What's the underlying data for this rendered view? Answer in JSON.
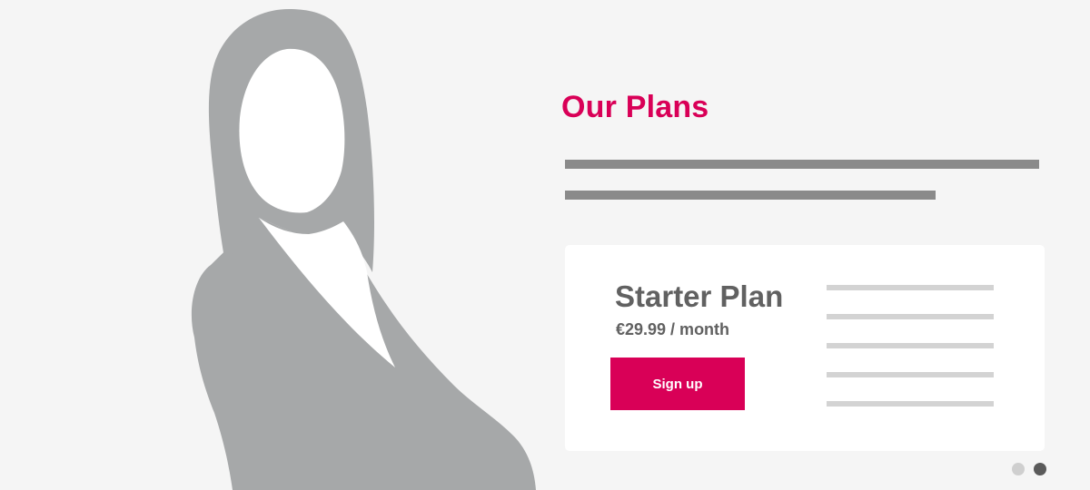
{
  "hero": {
    "figure_icon": "person-silhouette-icon",
    "title": "Our Plans",
    "intro_text_placeholder_lines": 2
  },
  "plan": {
    "name": "Starter Plan",
    "price": "€29.99 / month",
    "cta_label": "Sign up",
    "feature_placeholder_lines": 5
  },
  "carousel": {
    "slide_count": 2,
    "active_slide": 2
  },
  "colors": {
    "accent": "#d90057",
    "silhouette": "#a6a8a9",
    "text_dark": "#616161",
    "background": "#f5f5f5",
    "card": "#ffffff"
  }
}
